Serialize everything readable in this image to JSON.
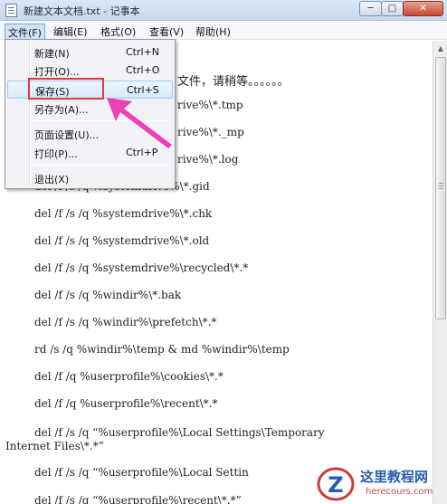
{
  "window": {
    "title": "新建文本文档.txt - 记事本",
    "min_glyph": "─",
    "max_glyph": "□",
    "close_glyph": "✕"
  },
  "menubar": {
    "file": "文件(F)",
    "edit": "编辑(E)",
    "format": "格式(O)",
    "view": "查看(V)",
    "help": "帮助(H)"
  },
  "file_menu": {
    "items": [
      {
        "label": "新建(N)",
        "shortcut": "Ctrl+N"
      },
      {
        "label": "打开(O)...",
        "shortcut": "Ctrl+O"
      },
      {
        "label": "保存(S)",
        "shortcut": "Ctrl+S"
      },
      {
        "label": "另存为(A)...",
        "shortcut": ""
      },
      {
        "label": "页面设置(U)...",
        "shortcut": ""
      },
      {
        "label": "打印(P)...",
        "shortcut": "Ctrl+P"
      },
      {
        "label": "退出(X)",
        "shortcut": ""
      }
    ]
  },
  "editor": {
    "lines": [
      "文件，请稍等。。。。。。",
      "rive%\\*.tmp",
      "rive%\\*._mp",
      "rive%\\*.log",
      "del /f /s /q %systemdrive%\\*.gid",
      "del /f /s /q %systemdrive%\\*.chk",
      "del /f /s /q %systemdrive%\\*.old",
      "del /f /s /q %systemdrive%\\recycled\\*.*",
      "del /f /s /q %windir%\\*.bak",
      "del /f /s /q %windir%\\prefetch\\*.*",
      "rd /s /q %windir%\\temp & md %windir%\\temp",
      "del /f /q %userprofile%\\cookies\\*.*",
      "del /f /q %userprofile%\\recent\\*.*",
      "del /f /s /q “%userprofile%\\Local Settings\\Temporary",
      "Internet Files\\*.*”",
      "del /f /s /q “%userprofile%\\Local Settin",
      "del /f /s /q “%userprofile%\\recent\\*.*”"
    ]
  },
  "scrollbar": {
    "up_glyph": "▲"
  },
  "watermark": {
    "name": "这里教程网",
    "url": "herecours.com",
    "logo_letter": "Z"
  },
  "colors": {
    "highlight": "#e03a3a",
    "arrow": "#ee3fb8"
  }
}
